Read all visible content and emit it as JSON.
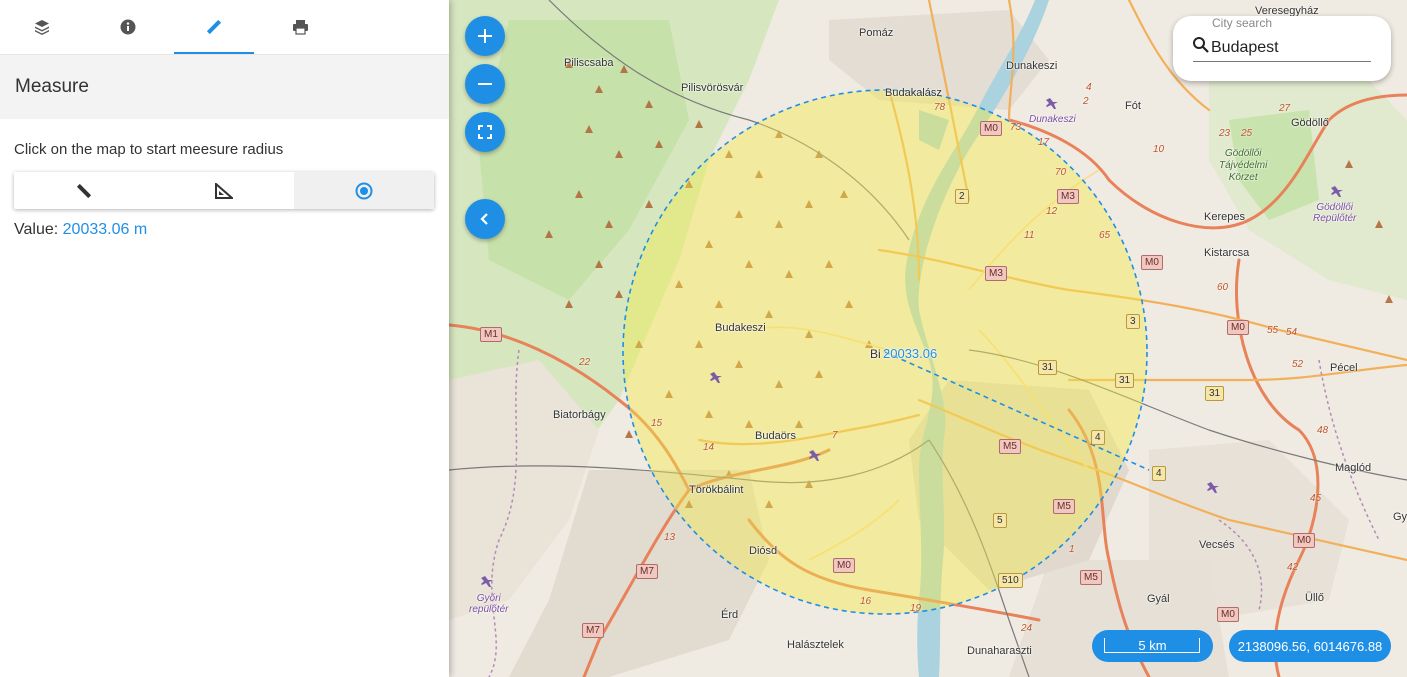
{
  "sidebar": {
    "tabs": [
      {
        "icon": "layers-icon",
        "active": false
      },
      {
        "icon": "info-icon",
        "active": false
      },
      {
        "icon": "ruler-icon",
        "active": true
      },
      {
        "icon": "print-icon",
        "active": false
      }
    ],
    "panel_title": "Measure",
    "hint": "Click on the map to start meesure radius",
    "modes": [
      {
        "icon": "ruler-icon",
        "active": false
      },
      {
        "icon": "set-square-icon",
        "active": false
      },
      {
        "icon": "radius-icon",
        "active": true
      }
    ],
    "value_label": "Value:",
    "value": "20033.06 m"
  },
  "map": {
    "controls": {
      "zoom_in_icon": "plus-icon",
      "zoom_out_icon": "minus-icon",
      "fullscreen_icon": "fullscreen-icon",
      "collapse_icon": "chevron-left-icon"
    },
    "search": {
      "label": "City search",
      "value": "Budapest",
      "icon": "search-icon"
    },
    "measure_label": "20033.06",
    "scale": "5 km",
    "coordinates": "2138096.56, 6014676.88",
    "colors": {
      "accent": "#1f8fe5",
      "circle_fill": "#f2e94e",
      "circle_stroke": "#1f8fe5"
    },
    "places": {
      "pomaz": "Pomáz",
      "piliscsaba": "Piliscsaba",
      "pilisvorosvar": "Pilisvörösvár",
      "budakalasz": "Budakalász",
      "dunakeszi": "Dunakeszi",
      "dunakeszi_air": "Dunakeszi",
      "fot": "Fót",
      "godollo": "Gödöllő",
      "veresegyhaz": "Veresegyház",
      "godolloi_forest": "Gödöllői\nTájvédelmi\nKörzet",
      "godolloi_airport": "Gödöllői\nRepülőtér",
      "kerepes": "Kerepes",
      "kistarcsa": "Kistarcsa",
      "budakeszi": "Budakeszi",
      "bi": "Bi",
      "pecel": "Pécel",
      "biatorbagy": "Biatorbágy",
      "budaors": "Budaörs",
      "torokbalint": "Törökbálint",
      "maglod": "Maglód",
      "gy": "Gy",
      "diosd": "Diósd",
      "vecses": "Vecsés",
      "gyori_airport": "Győri\nrepülőtér",
      "erd": "Érd",
      "gyal": "Gyál",
      "ullo": "Üllő",
      "halasztelek": "Halásztelek",
      "dunaharaszti": "Dunaharaszti"
    },
    "shields": {
      "m0_a": "M0",
      "m3_a": "M3",
      "m0_b": "M0",
      "m3_b": "M3",
      "m1": "M1",
      "m0_c": "M0",
      "m5_a": "M5",
      "m5_b": "M5",
      "m5_c": "M5",
      "m0_d": "M0",
      "m7_a": "M7",
      "m7_b": "M7",
      "m0_e": "M0",
      "m0_f": "M0",
      "r2": "2",
      "r3": "3",
      "r31_a": "31",
      "r31_b": "31",
      "r31_c": "31",
      "r4_a": "4",
      "r4_b": "4",
      "r5": "5",
      "r510": "510"
    },
    "road_numbers": {
      "n78": "78",
      "n73": "73",
      "n17": "17",
      "n4": "4",
      "n2": "2",
      "n70": "70",
      "n12": "12",
      "n11": "11",
      "n65": "65",
      "n27": "27",
      "n23": "23",
      "n25": "25",
      "n10": "10",
      "n60": "60",
      "n55": "55",
      "n54": "54",
      "n52": "52",
      "n48": "48",
      "n45": "45",
      "n42": "42",
      "n22": "22",
      "n15": "15",
      "n13": "13",
      "n14": "14",
      "n7": "7",
      "n16": "16",
      "n19": "19",
      "n24": "24",
      "n1": "1"
    }
  }
}
